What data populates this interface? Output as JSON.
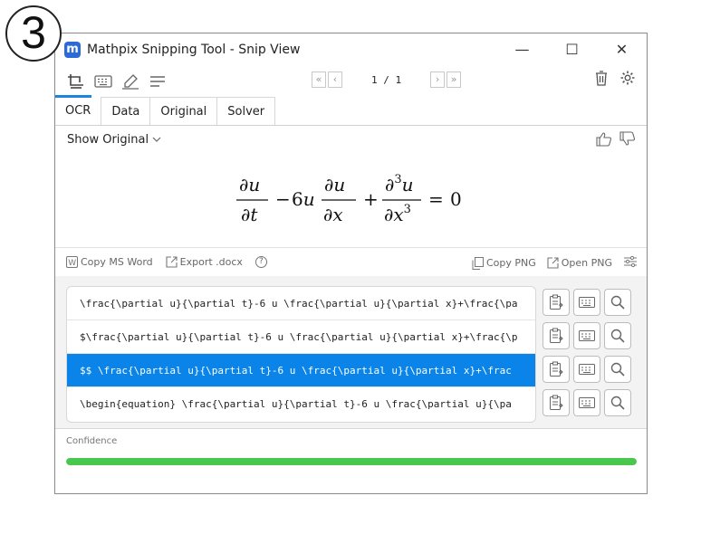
{
  "step_badge": "3",
  "window": {
    "title": "Mathpix Snipping Tool - Snip View",
    "controls": {
      "minimize": "—",
      "maximize": "☐",
      "close": "✕"
    }
  },
  "toolbar": {
    "pager": {
      "first": "«",
      "prev": "‹",
      "text": "1 / 1",
      "next": "›",
      "last": "»"
    }
  },
  "tabs": [
    {
      "label": "OCR"
    },
    {
      "label": "Data"
    },
    {
      "label": "Original"
    },
    {
      "label": "Solver"
    }
  ],
  "show_original": "Show Original",
  "actions": {
    "copy_ms_word": "Copy MS Word",
    "export_docx": "Export .docx",
    "help": "?",
    "copy_png": "Copy PNG",
    "open_png": "Open PNG"
  },
  "results": [
    {
      "text": "\\frac{\\partial u}{\\partial t}-6 u \\frac{\\partial u}{\\partial x}+\\frac{\\pa",
      "selected": false
    },
    {
      "text": "$\\frac{\\partial u}{\\partial t}-6 u \\frac{\\partial u}{\\partial x}+\\frac{\\p",
      "selected": false
    },
    {
      "text": "$$  \\frac{\\partial u}{\\partial t}-6 u \\frac{\\partial u}{\\partial x}+\\frac",
      "selected": true
    },
    {
      "text": "\\begin{equation}  \\frac{\\partial u}{\\partial t}-6 u \\frac{\\partial u}{\\pa",
      "selected": false
    }
  ],
  "confidence": {
    "label": "Confidence",
    "value": 1.0
  },
  "colors": {
    "accent": "#0a84e8",
    "confidence": "#49c84d",
    "logo": "#2c6ad8"
  }
}
